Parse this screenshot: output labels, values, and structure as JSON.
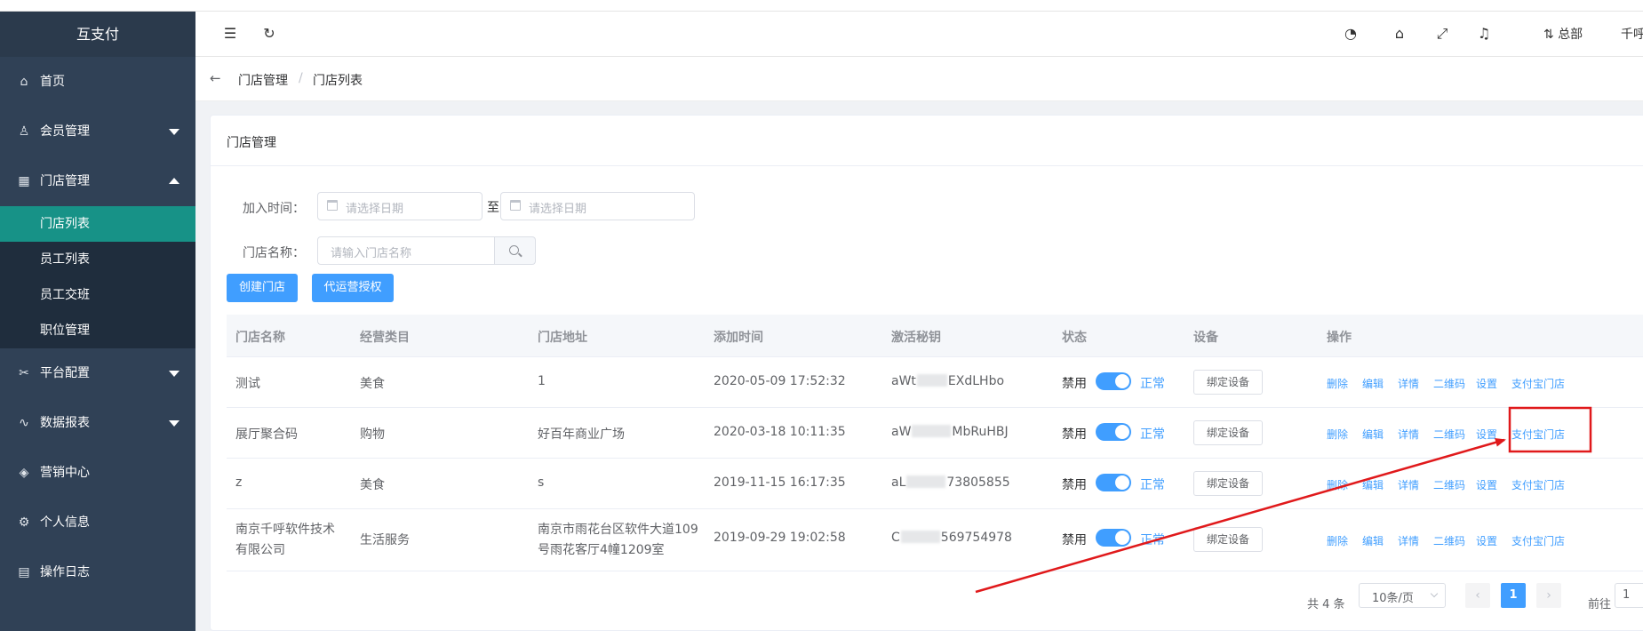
{
  "app": {
    "brand": "互支付"
  },
  "sidebar": {
    "items": [
      {
        "label": "首页",
        "icon": "home-icon"
      },
      {
        "label": "会员管理",
        "icon": "user-icon"
      },
      {
        "label": "门店管理",
        "icon": "store-icon"
      },
      {
        "label": "平台配置",
        "icon": "tools-icon"
      },
      {
        "label": "数据报表",
        "icon": "chart-icon"
      },
      {
        "label": "营销中心",
        "icon": "box-icon"
      },
      {
        "label": "个人信息",
        "icon": "gear-icon"
      },
      {
        "label": "操作日志",
        "icon": "log-icon"
      }
    ],
    "submenu": [
      {
        "label": "门店列表"
      },
      {
        "label": "员工列表"
      },
      {
        "label": "员工交班"
      },
      {
        "label": "职位管理"
      }
    ]
  },
  "header": {
    "org": "总部",
    "user": "千呼"
  },
  "breadcrumb": {
    "parent": "门店管理",
    "current": "门店列表",
    "separator": "/"
  },
  "card": {
    "title": "门店管理"
  },
  "filters": {
    "join_time_label": "加入时间：",
    "date_placeholder": "请选择日期",
    "to_text": "至",
    "store_name_label": "门店名称：",
    "store_name_placeholder": "请输入门店名称"
  },
  "buttons": {
    "create": "创建门店",
    "authorize": "代运营授权"
  },
  "table": {
    "headers": [
      "门店名称",
      "经营类目",
      "门店地址",
      "添加时间",
      "激活秘钥",
      "状态",
      "设备",
      "操作"
    ],
    "rows": [
      {
        "name": "测试",
        "category": "美食",
        "address": "1",
        "time": "2020-05-09 17:52:32",
        "key_start": "aWt",
        "key_end": "EXdLHbo",
        "status_off": "禁用",
        "status_on": "正常",
        "device_btn": "绑定设备"
      },
      {
        "name": "展厅聚合码",
        "category": "购物",
        "address": "好百年商业广场",
        "time": "2020-03-18 10:11:35",
        "key_start": "aW",
        "key_end": "MbRuHBJ",
        "status_off": "禁用",
        "status_on": "正常",
        "device_btn": "绑定设备"
      },
      {
        "name": "z",
        "category": "美食",
        "address": "s",
        "time": "2019-11-15 16:17:35",
        "key_start": "aL",
        "key_end": "73805855",
        "status_off": "禁用",
        "status_on": "正常",
        "device_btn": "绑定设备"
      },
      {
        "name": "南京千呼软件技术有限公司",
        "category": "生活服务",
        "address": "南京市雨花台区软件大道109号雨花客厅4幢1209室",
        "time": "2019-09-29 19:02:58",
        "key_start": "C",
        "key_end": "569754978",
        "status_off": "禁用",
        "status_on": "正常",
        "device_btn": "绑定设备"
      }
    ],
    "actions": [
      "删除",
      "编辑",
      "详情",
      "二维码",
      "设置",
      "支付宝门店"
    ]
  },
  "pagination": {
    "total": "共 4 条",
    "page_size": "10条/页",
    "current": "1",
    "goto_label": "前往",
    "goto_value": "1"
  },
  "colors": {
    "primary": "#409eff",
    "sidebar_bg": "#304156",
    "submenu_bg": "#1f2d3d",
    "active_bg": "#179287",
    "annotation": "#e0191b"
  }
}
